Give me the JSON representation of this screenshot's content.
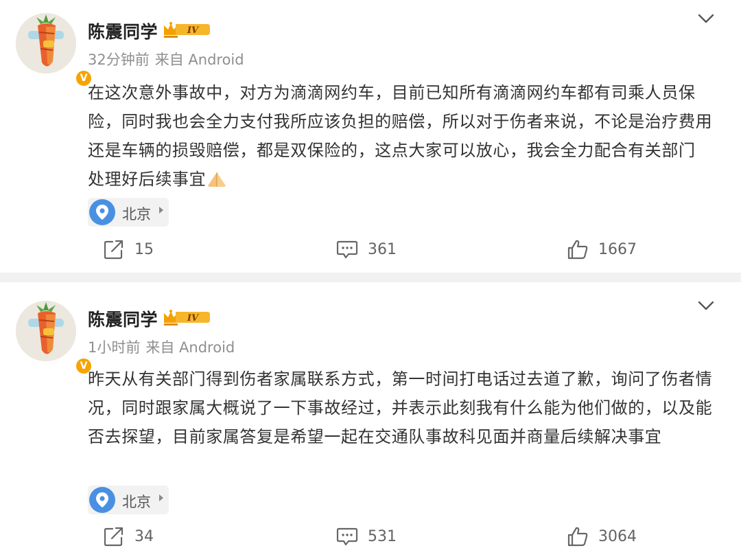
{
  "colors": {
    "accent_gold": "#f6a400",
    "location_blue": "#4a90e2",
    "meta_gray": "#8f8f8f",
    "text": "#333333"
  },
  "posts": [
    {
      "username": "陈震同学",
      "badge_level": "IV",
      "verified_badge": "V",
      "time": "32分钟前",
      "source": "来自 Android",
      "content": "在这次意外事故中，对方为滴滴网约车，目前已知所有滴滴网约车都有司乘人员保险，同时我也会全力支付我所应该负担的赔偿，所以对于伤者来说，不论是治疗费用还是车辆的损毁赔偿，都是双保险的，这点大家可以放心，我会全力配合有关部门 处理好后续事宜",
      "emoji": "praying-hands",
      "location": "北京",
      "reposts": "15",
      "comments": "361",
      "likes": "1667"
    },
    {
      "username": "陈震同学",
      "badge_level": "IV",
      "verified_badge": "V",
      "time": "1小时前",
      "source": "来自 Android",
      "content": "昨天从有关部门得到伤者家属联系方式，第一时间打电话过去道了歉，询问了伤者情况，同时跟家属大概说了一下事故经过，并表示此刻我有什么能为他们做的，以及能否去探望，目前家属答复是希望一起在交通队事故科见面并商量后续解决事宜",
      "location": "北京",
      "reposts": "34",
      "comments": "531",
      "likes": "3064"
    }
  ],
  "icons": {
    "more": "chevron-down-icon",
    "repost": "repost-icon",
    "comment": "comment-icon",
    "like": "like-icon",
    "location": "location-pin-icon",
    "vip": "crown-badge-icon"
  }
}
